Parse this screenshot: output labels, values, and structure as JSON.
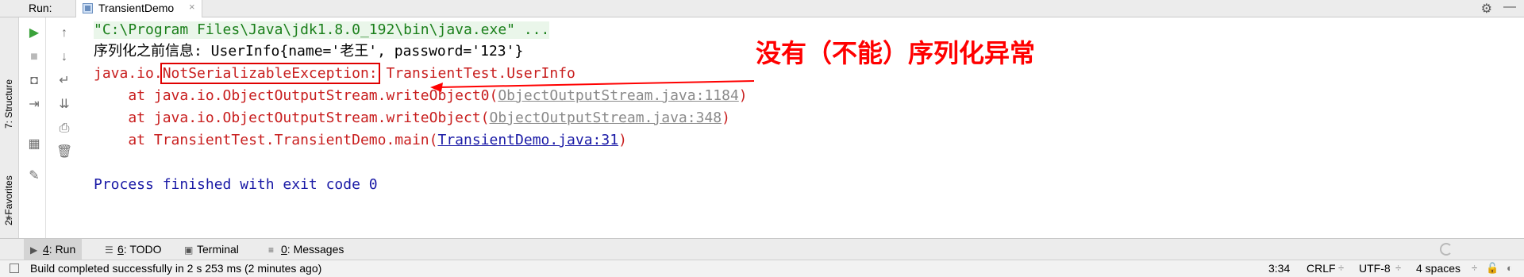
{
  "header": {
    "run_label": "Run:",
    "tab_label": "TransientDemo",
    "tab_close": "×",
    "settings_icon": "⚙",
    "minimize_icon": "—"
  },
  "side_strip": {
    "structure_label": "7: Structure",
    "favorites_label": "2: Favorites"
  },
  "console": {
    "command": "\"C:\\Program Files\\Java\\jdk1.8.0_192\\bin\\java.exe\" ...",
    "output_line": "序列化之前信息: UserInfo{name='老王', password='123'}",
    "exception_prefix": "java.io.",
    "exception_name": "NotSerializableException:",
    "exception_class": " TransientTest.UserInfo",
    "stack": [
      {
        "prefix": "    at java.io.ObjectOutputStream.writeObject0(",
        "link": "ObjectOutputStream.java:1184",
        "suffix": ")"
      },
      {
        "prefix": "    at java.io.ObjectOutputStream.writeObject(",
        "link": "ObjectOutputStream.java:348",
        "suffix": ")"
      },
      {
        "prefix": "    at TransientTest.TransientDemo.main(",
        "link": "TransientDemo.java:31",
        "suffix": ")"
      }
    ],
    "exit_line": "Process finished with exit code 0"
  },
  "annotation": {
    "text": "没有（不能）序列化异常",
    "color": "#ff0000"
  },
  "tool_tabs": [
    {
      "icon": "play-icon",
      "key": "4",
      "label": ": Run",
      "active": true
    },
    {
      "icon": "todo-icon",
      "key": "6",
      "label": ": TODO",
      "active": false
    },
    {
      "icon": "terminal-icon",
      "key": "",
      "label": "Terminal",
      "active": false
    },
    {
      "icon": "messages-icon",
      "key": "0",
      "label": ": Messages",
      "active": false
    }
  ],
  "status_bar": {
    "message": "Build completed successfully in 2 s 253 ms (2 minutes ago)",
    "position": "3:34",
    "line_separator": "CRLF",
    "encoding": "UTF-8",
    "indent": "4 spaces"
  },
  "colors": {
    "error_red": "#c81e1e",
    "command_green": "#1a7f1a",
    "link_blue": "#1a1aa6"
  }
}
